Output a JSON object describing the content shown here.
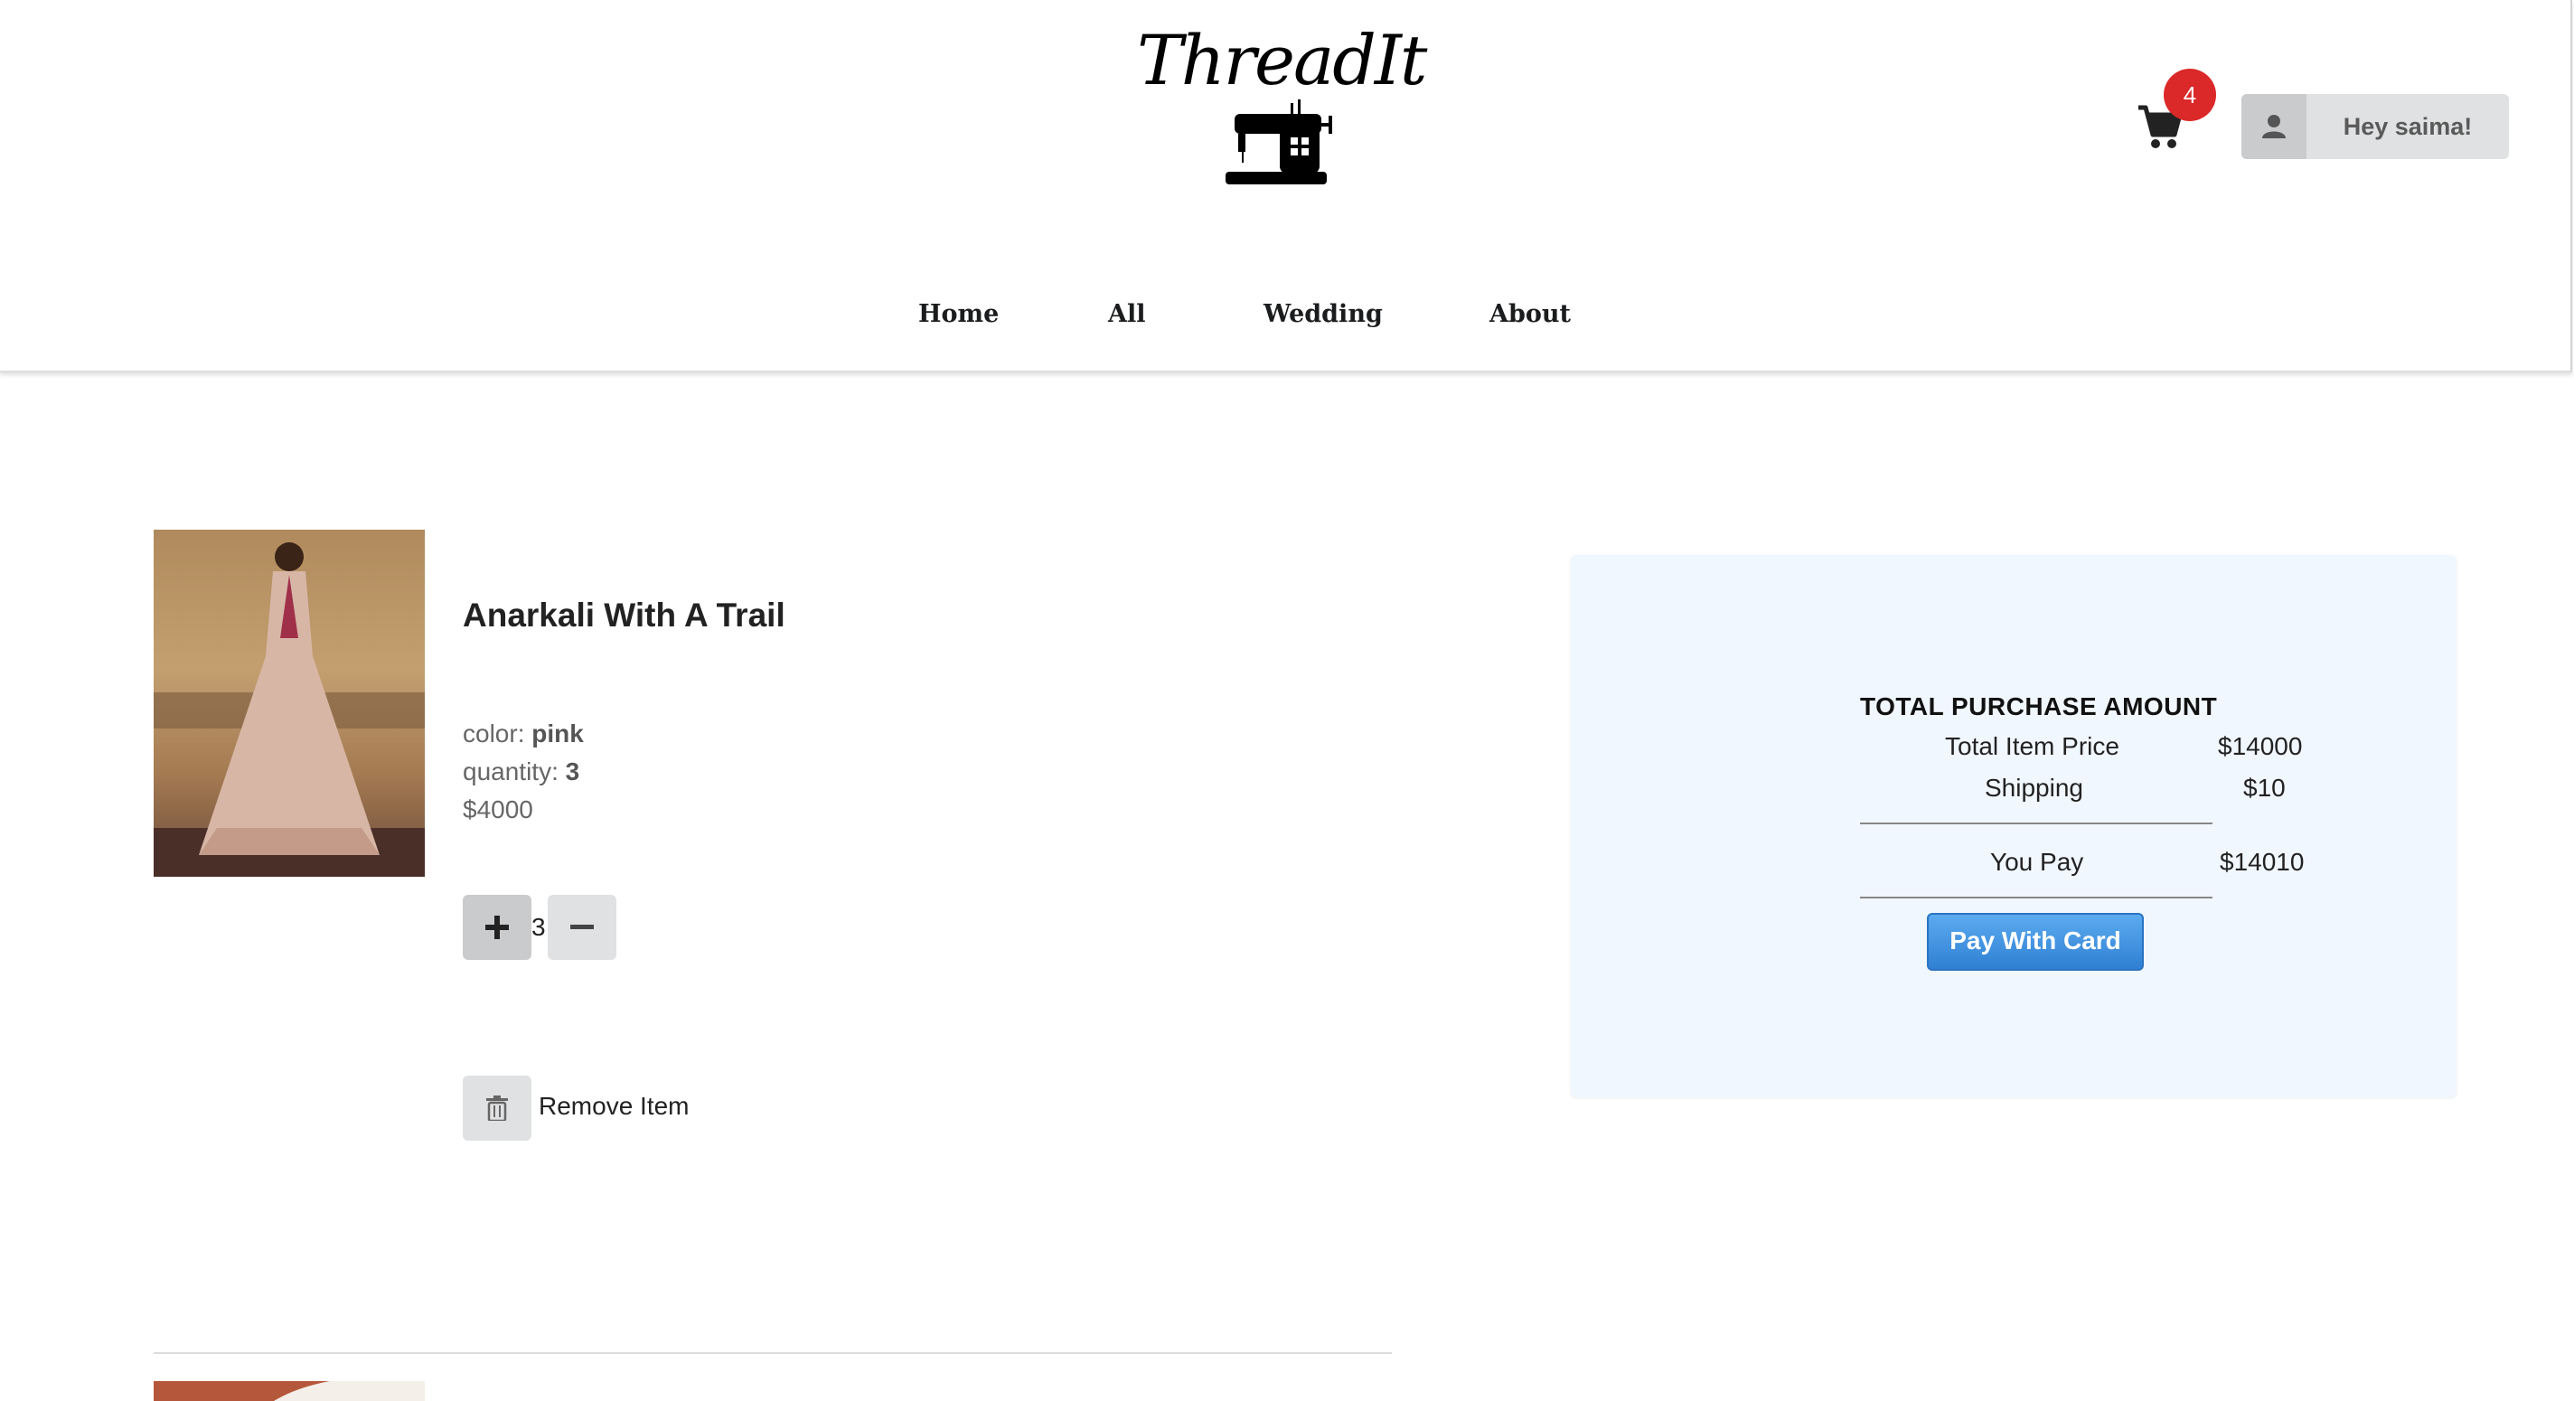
{
  "header": {
    "logo_text": "ThreadIt",
    "cart_count": "4",
    "user_greeting": "Hey saima!",
    "nav": [
      "Home",
      "All",
      "Wedding",
      "About"
    ]
  },
  "cart_item": {
    "title": "Anarkali With A Trail",
    "color_label": "color: ",
    "color_value": "pink",
    "quantity_label": "quantity: ",
    "quantity_value": "3",
    "price": "$4000",
    "stepper_value": "3",
    "remove_label": "Remove Item"
  },
  "summary": {
    "title": "TOTAL PURCHASE AMOUNT",
    "item_price_label": "Total Item Price",
    "item_price_value": "$14000",
    "shipping_label": "Shipping",
    "shipping_value": "$10",
    "you_pay_label": "You Pay",
    "you_pay_value": "$14010",
    "pay_button": "Pay With Card"
  },
  "colors": {
    "badge": "#db2828",
    "pay_button": "#2f80d3",
    "summary_bg": "#f1f7fe"
  }
}
